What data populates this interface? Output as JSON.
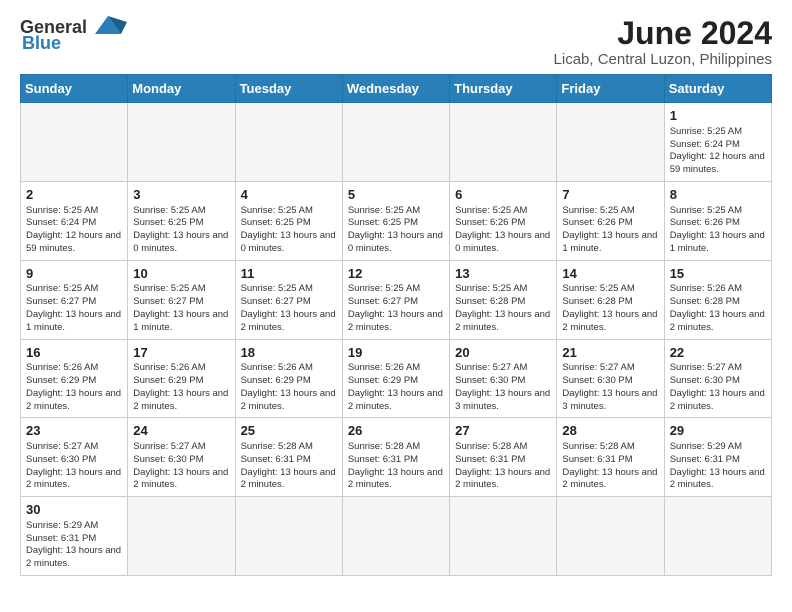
{
  "logo": {
    "text_general": "General",
    "text_blue": "Blue"
  },
  "title": "June 2024",
  "location": "Licab, Central Luzon, Philippines",
  "weekdays": [
    "Sunday",
    "Monday",
    "Tuesday",
    "Wednesday",
    "Thursday",
    "Friday",
    "Saturday"
  ],
  "weeks": [
    [
      {
        "day": "",
        "info": ""
      },
      {
        "day": "",
        "info": ""
      },
      {
        "day": "",
        "info": ""
      },
      {
        "day": "",
        "info": ""
      },
      {
        "day": "",
        "info": ""
      },
      {
        "day": "",
        "info": ""
      },
      {
        "day": "1",
        "info": "Sunrise: 5:25 AM\nSunset: 6:24 PM\nDaylight: 12 hours\nand 59 minutes."
      }
    ],
    [
      {
        "day": "2",
        "info": "Sunrise: 5:25 AM\nSunset: 6:24 PM\nDaylight: 12 hours\nand 59 minutes."
      },
      {
        "day": "3",
        "info": "Sunrise: 5:25 AM\nSunset: 6:25 PM\nDaylight: 13 hours\nand 0 minutes."
      },
      {
        "day": "4",
        "info": "Sunrise: 5:25 AM\nSunset: 6:25 PM\nDaylight: 13 hours\nand 0 minutes."
      },
      {
        "day": "5",
        "info": "Sunrise: 5:25 AM\nSunset: 6:25 PM\nDaylight: 13 hours\nand 0 minutes."
      },
      {
        "day": "6",
        "info": "Sunrise: 5:25 AM\nSunset: 6:26 PM\nDaylight: 13 hours\nand 0 minutes."
      },
      {
        "day": "7",
        "info": "Sunrise: 5:25 AM\nSunset: 6:26 PM\nDaylight: 13 hours\nand 1 minute."
      },
      {
        "day": "8",
        "info": "Sunrise: 5:25 AM\nSunset: 6:26 PM\nDaylight: 13 hours\nand 1 minute."
      }
    ],
    [
      {
        "day": "9",
        "info": "Sunrise: 5:25 AM\nSunset: 6:27 PM\nDaylight: 13 hours\nand 1 minute."
      },
      {
        "day": "10",
        "info": "Sunrise: 5:25 AM\nSunset: 6:27 PM\nDaylight: 13 hours\nand 1 minute."
      },
      {
        "day": "11",
        "info": "Sunrise: 5:25 AM\nSunset: 6:27 PM\nDaylight: 13 hours\nand 2 minutes."
      },
      {
        "day": "12",
        "info": "Sunrise: 5:25 AM\nSunset: 6:27 PM\nDaylight: 13 hours\nand 2 minutes."
      },
      {
        "day": "13",
        "info": "Sunrise: 5:25 AM\nSunset: 6:28 PM\nDaylight: 13 hours\nand 2 minutes."
      },
      {
        "day": "14",
        "info": "Sunrise: 5:25 AM\nSunset: 6:28 PM\nDaylight: 13 hours\nand 2 minutes."
      },
      {
        "day": "15",
        "info": "Sunrise: 5:26 AM\nSunset: 6:28 PM\nDaylight: 13 hours\nand 2 minutes."
      }
    ],
    [
      {
        "day": "16",
        "info": "Sunrise: 5:26 AM\nSunset: 6:29 PM\nDaylight: 13 hours\nand 2 minutes."
      },
      {
        "day": "17",
        "info": "Sunrise: 5:26 AM\nSunset: 6:29 PM\nDaylight: 13 hours\nand 2 minutes."
      },
      {
        "day": "18",
        "info": "Sunrise: 5:26 AM\nSunset: 6:29 PM\nDaylight: 13 hours\nand 2 minutes."
      },
      {
        "day": "19",
        "info": "Sunrise: 5:26 AM\nSunset: 6:29 PM\nDaylight: 13 hours\nand 2 minutes."
      },
      {
        "day": "20",
        "info": "Sunrise: 5:27 AM\nSunset: 6:30 PM\nDaylight: 13 hours\nand 3 minutes."
      },
      {
        "day": "21",
        "info": "Sunrise: 5:27 AM\nSunset: 6:30 PM\nDaylight: 13 hours\nand 3 minutes."
      },
      {
        "day": "22",
        "info": "Sunrise: 5:27 AM\nSunset: 6:30 PM\nDaylight: 13 hours\nand 2 minutes."
      }
    ],
    [
      {
        "day": "23",
        "info": "Sunrise: 5:27 AM\nSunset: 6:30 PM\nDaylight: 13 hours\nand 2 minutes."
      },
      {
        "day": "24",
        "info": "Sunrise: 5:27 AM\nSunset: 6:30 PM\nDaylight: 13 hours\nand 2 minutes."
      },
      {
        "day": "25",
        "info": "Sunrise: 5:28 AM\nSunset: 6:31 PM\nDaylight: 13 hours\nand 2 minutes."
      },
      {
        "day": "26",
        "info": "Sunrise: 5:28 AM\nSunset: 6:31 PM\nDaylight: 13 hours\nand 2 minutes."
      },
      {
        "day": "27",
        "info": "Sunrise: 5:28 AM\nSunset: 6:31 PM\nDaylight: 13 hours\nand 2 minutes."
      },
      {
        "day": "28",
        "info": "Sunrise: 5:28 AM\nSunset: 6:31 PM\nDaylight: 13 hours\nand 2 minutes."
      },
      {
        "day": "29",
        "info": "Sunrise: 5:29 AM\nSunset: 6:31 PM\nDaylight: 13 hours\nand 2 minutes."
      }
    ],
    [
      {
        "day": "30",
        "info": "Sunrise: 5:29 AM\nSunset: 6:31 PM\nDaylight: 13 hours\nand 2 minutes."
      },
      {
        "day": "",
        "info": ""
      },
      {
        "day": "",
        "info": ""
      },
      {
        "day": "",
        "info": ""
      },
      {
        "day": "",
        "info": ""
      },
      {
        "day": "",
        "info": ""
      },
      {
        "day": "",
        "info": ""
      }
    ]
  ]
}
